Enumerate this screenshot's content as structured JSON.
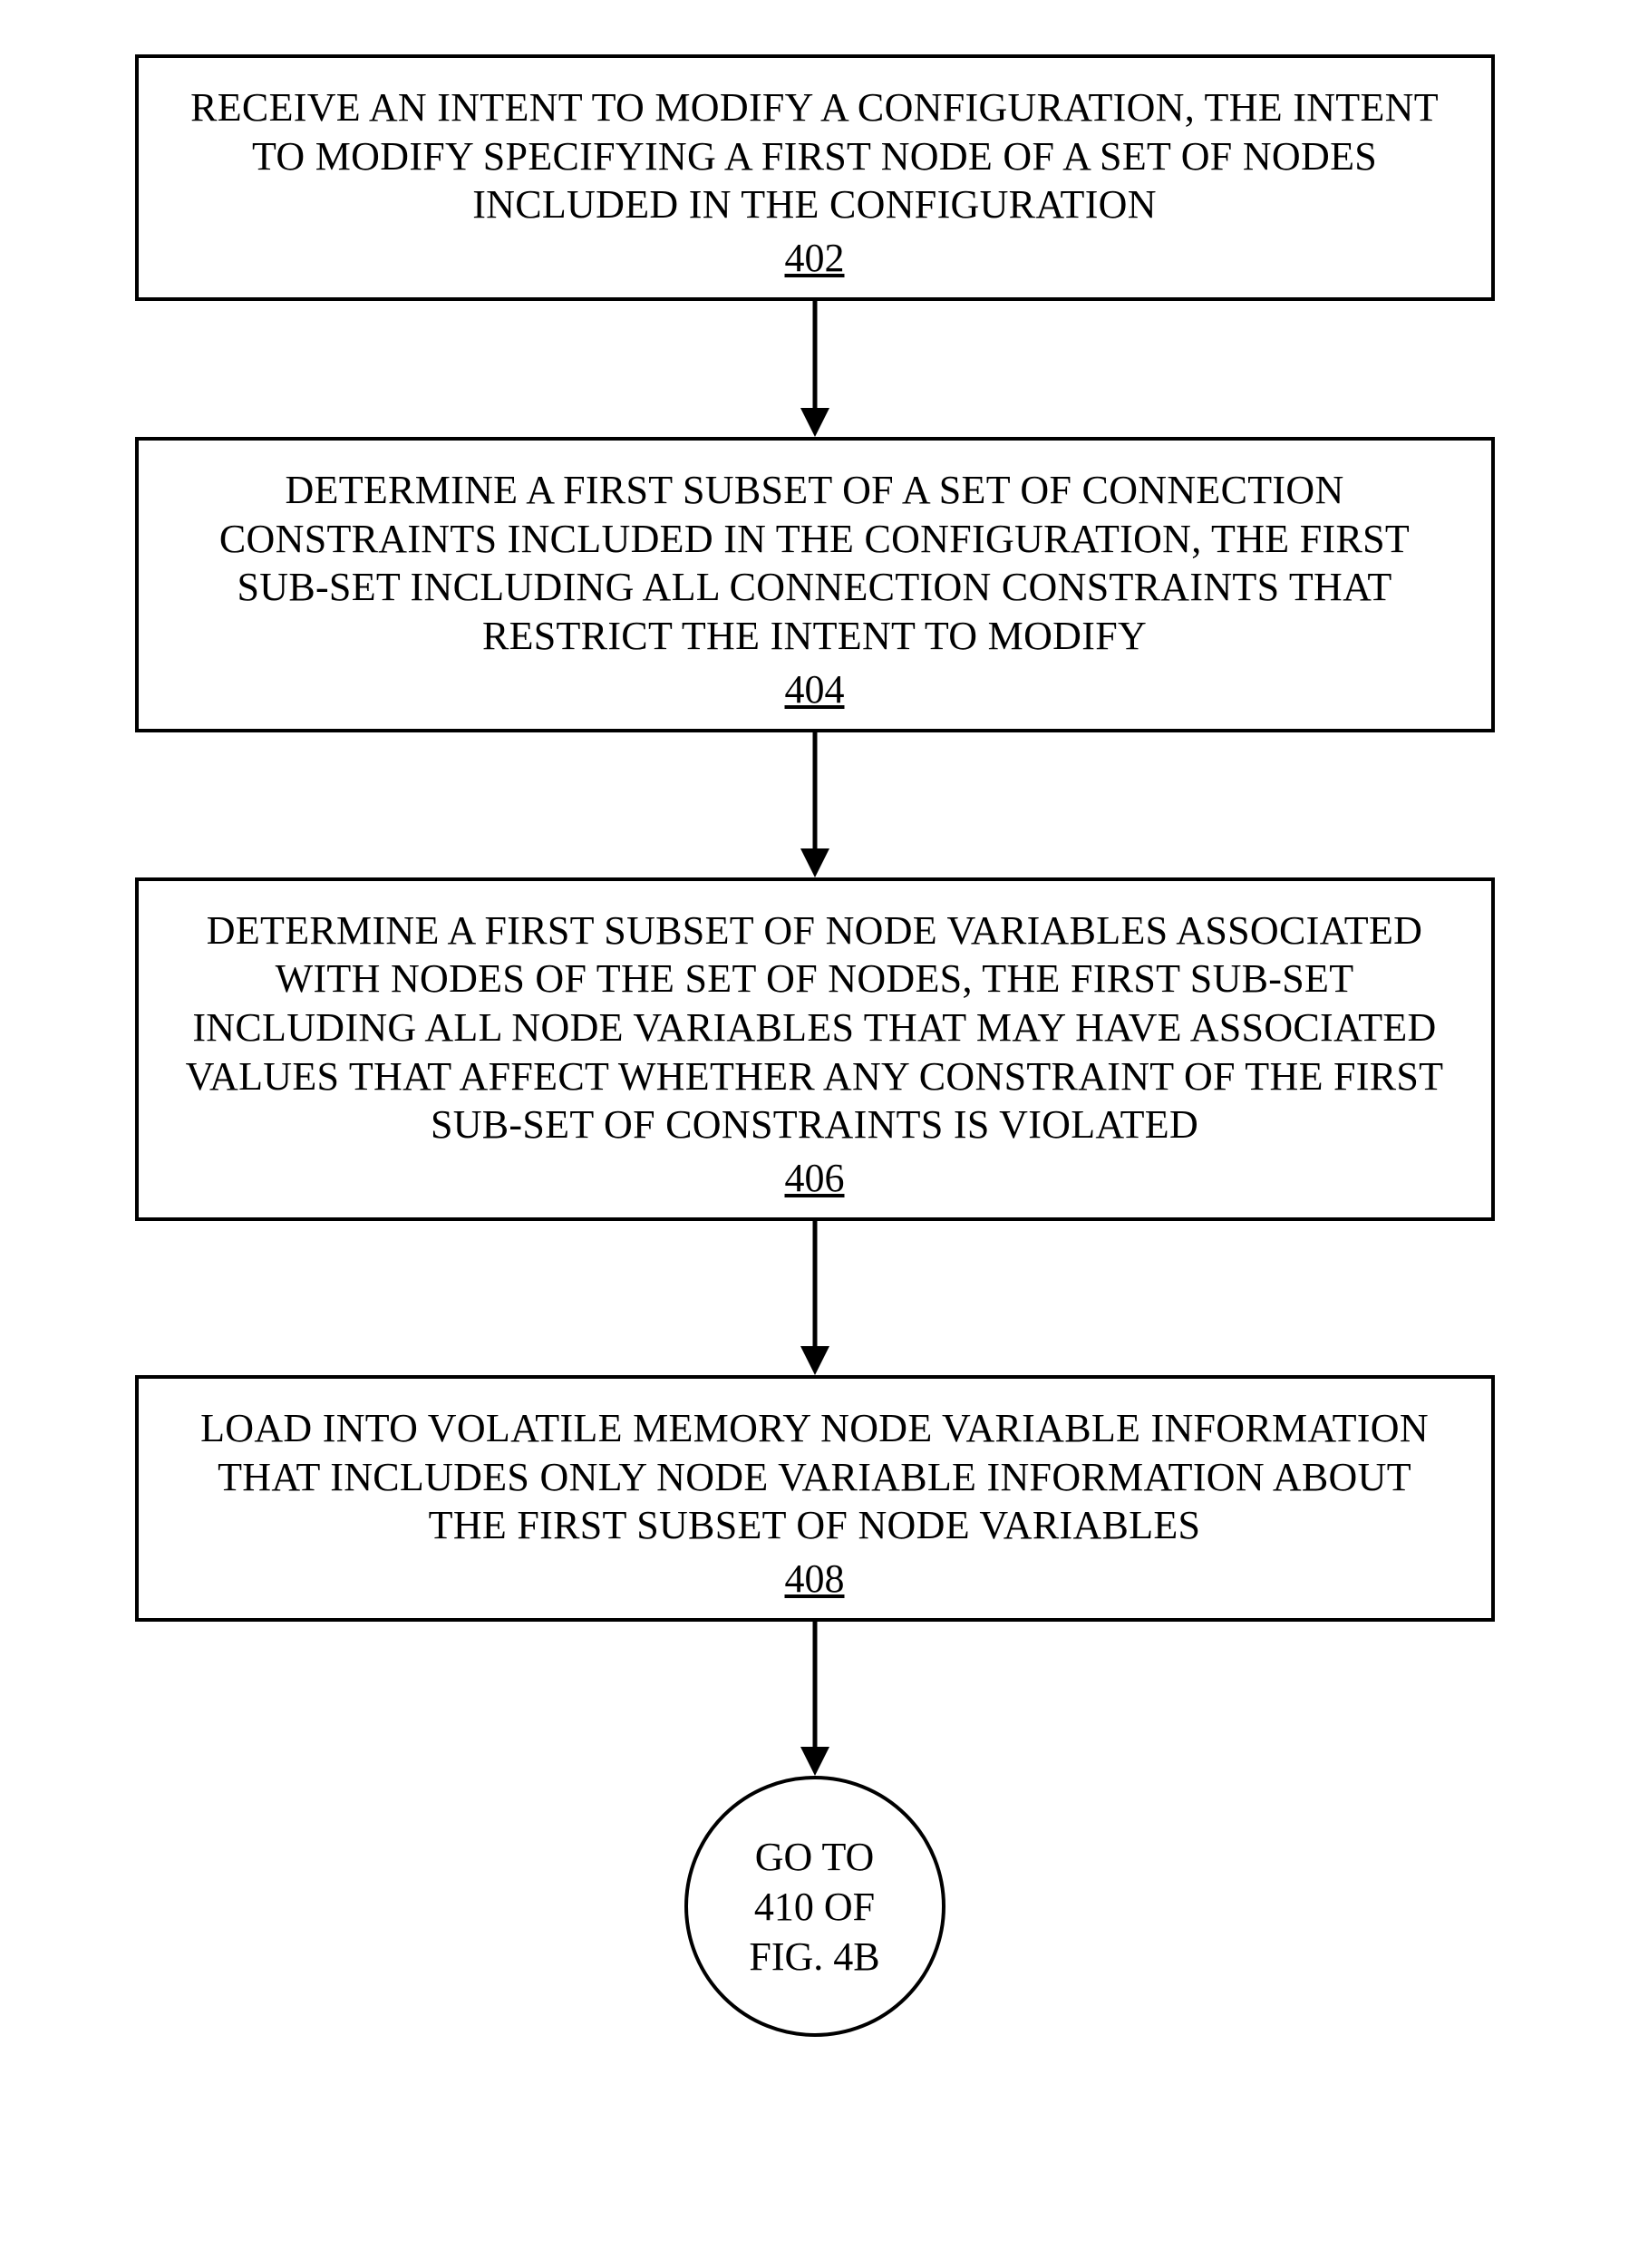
{
  "steps": [
    {
      "text": "RECEIVE AN INTENT TO MODIFY A CONFIGURATION, THE INTENT TO MODIFY SPECIFYING A FIRST NODE OF A SET OF NODES INCLUDED IN THE CONFIGURATION",
      "num": "402"
    },
    {
      "text": "DETERMINE A FIRST SUBSET OF A SET OF CONNECTION CONSTRAINTS INCLUDED IN THE CONFIGURATION, THE FIRST SUB-SET INCLUDING ALL CONNECTION CONSTRAINTS THAT RESTRICT THE INTENT TO MODIFY",
      "num": "404"
    },
    {
      "text": "DETERMINE A FIRST SUBSET OF NODE VARIABLES ASSOCIATED WITH NODES OF THE SET OF NODES, THE FIRST SUB-SET INCLUDING ALL NODE VARIABLES THAT MAY HAVE ASSOCIATED VALUES THAT AFFECT WHETHER ANY CONSTRAINT OF THE FIRST SUB-SET OF CONSTRAINTS IS VIOLATED",
      "num": "406"
    },
    {
      "text": "LOAD INTO VOLATILE MEMORY NODE VARIABLE INFORMATION THAT INCLUDES ONLY NODE VARIABLE INFORMATION ABOUT THE FIRST SUBSET OF NODE VARIABLES",
      "num": "408"
    }
  ],
  "connector": {
    "line1": "GO TO",
    "line2": "410 OF",
    "line3": "FIG. 4B"
  },
  "arrows": {
    "after_402": 150,
    "after_404": 160,
    "after_406": 170,
    "after_408": 170
  }
}
